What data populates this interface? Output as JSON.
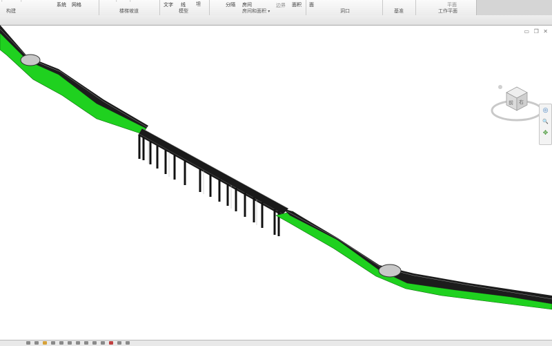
{
  "ribbon": {
    "items": {
      "system": "系统",
      "grid": "网格",
      "text": "文字",
      "line": "线",
      "mark": "坦",
      "split": "分隔",
      "room": "房间",
      "area": "面积",
      "region": "边界",
      "floor": "面",
      "plane": "平面"
    },
    "groups": {
      "build": "构建",
      "stair_ramp": "楼梯坡道",
      "model": "模型",
      "room_area": "房间和面积",
      "room_area_dropdown": "▾",
      "opening": "洞口",
      "datum": "基准",
      "work_plane": "工作平面"
    }
  },
  "viewport": {
    "controls": {
      "minimize": "▭",
      "restore": "❐",
      "close": "✕"
    },
    "viewcube": {
      "face_label": "前",
      "side_label": "右"
    },
    "navbar": {
      "wheel": "◎",
      "zoom": "🔍",
      "pan": "✥"
    }
  },
  "colors": {
    "terrain_green": "#1fd11f",
    "road_dark": "#1c1c1c",
    "node_grey": "#c8c8c8"
  }
}
